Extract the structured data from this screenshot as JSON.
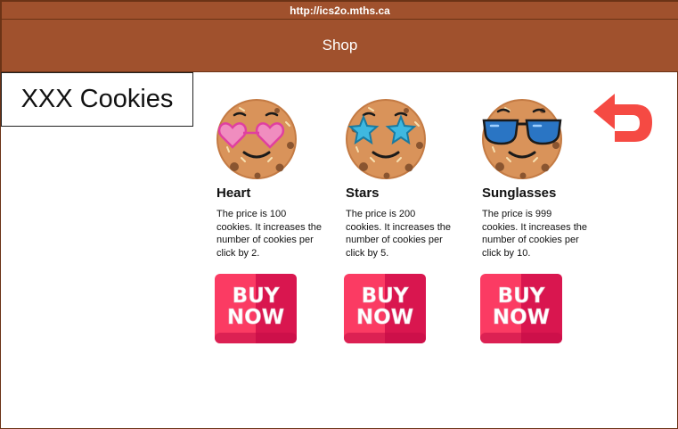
{
  "browser": {
    "url": "http://ics2o.mths.ca"
  },
  "header": {
    "title": "Shop"
  },
  "brand": {
    "name": "XXX Cookies"
  },
  "products": [
    {
      "name": "Heart",
      "description": "The price is 100 cookies. It increases the number of cookies per click by 2.",
      "icon": "cookie-heart-eyes-icon",
      "buy_label": "BUY NOW"
    },
    {
      "name": "Stars",
      "description": "The price is 200 cookies. It increases the number of cookies per click by 5.",
      "icon": "cookie-star-eyes-icon",
      "buy_label": "BUY NOW"
    },
    {
      "name": "Sunglasses",
      "description": "The price is 999 cookies. It increases the number of cookies per click by 10.",
      "icon": "cookie-sunglasses-icon",
      "buy_label": "BUY NOW"
    }
  ],
  "colors": {
    "bar": "#a0512d",
    "bar_border": "#6b3316",
    "back_arrow": "#f54a43",
    "buy_button": "#fb3b63",
    "buy_button_dark": "#d9164f"
  }
}
